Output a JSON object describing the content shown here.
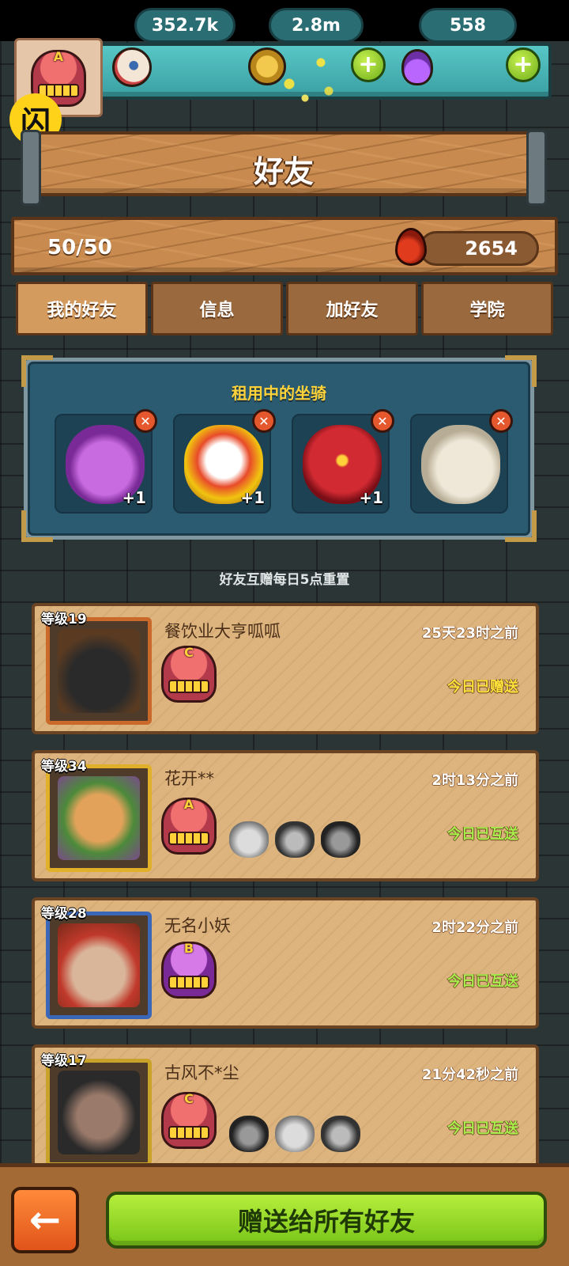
{
  "currencies": {
    "eyes": "352.7k",
    "coins": "2.8m",
    "potions": "558"
  },
  "player": {
    "grade": "A"
  },
  "page": {
    "title": "好友"
  },
  "stats": {
    "friend_count": "50/50",
    "blood": "2654"
  },
  "tabs": [
    {
      "label": "我的好友",
      "active": true
    },
    {
      "label": "信息",
      "active": false
    },
    {
      "label": "加好友",
      "active": false
    },
    {
      "label": "学院",
      "active": false
    }
  ],
  "mounts": {
    "title": "租用中的坐骑",
    "slots": [
      {
        "name": "purple-horned-monster",
        "bonus": "+1",
        "color": "#a24bc4"
      },
      {
        "name": "lion-dance-head",
        "bonus": "+1",
        "color": "#e8e4d6"
      },
      {
        "name": "red-rose",
        "bonus": "+1",
        "color": "#b01e28"
      },
      {
        "name": "white-rabbit",
        "bonus": "",
        "color": "#d9d2c2"
      }
    ]
  },
  "notice": "好友互赠每日5点重置",
  "friends": [
    {
      "level": "等级19",
      "name": "餐饮业大亨呱呱",
      "time": "25天23时之前",
      "status": "今日已赠送",
      "grade": "C",
      "status_color": "#ffe23a"
    },
    {
      "level": "等级34",
      "name": "花开**",
      "time": "2时13分之前",
      "status": "今日已互送",
      "grade": "A",
      "status_color": "#a8f04c"
    },
    {
      "level": "等级28",
      "name": "无名小妖",
      "time": "2时22分之前",
      "status": "今日已互送",
      "grade": "B",
      "status_color": "#a8f04c"
    },
    {
      "level": "等级17",
      "name": "古风不*尘",
      "time": "21分42秒之前",
      "status": "今日已互送",
      "grade": "C",
      "status_color": "#a8f04c"
    }
  ],
  "pet_bonus": "+1",
  "actions": {
    "back": "←",
    "gift_all": "赠送给所有好友"
  }
}
